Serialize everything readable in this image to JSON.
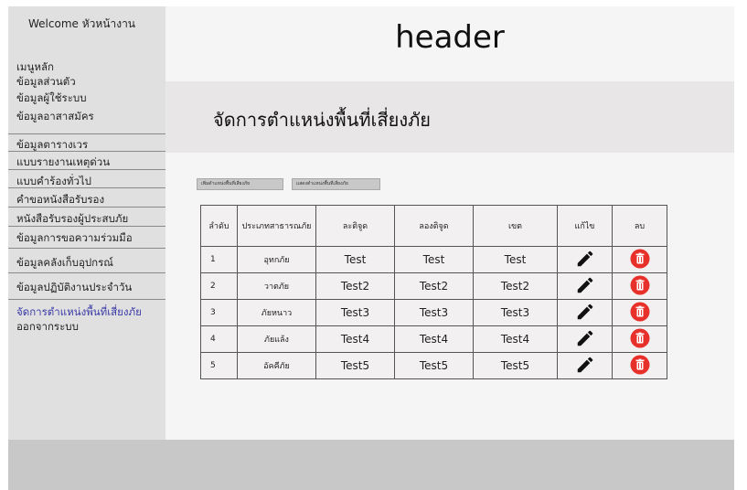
{
  "sidebar": {
    "welcome": "Welcome หัวหน้างาน",
    "items": [
      {
        "label": "เมนูหลัก"
      },
      {
        "label": "ข้อมูลส่วนตัว"
      },
      {
        "label": "ข้อมูลผู้ใช้ระบบ"
      },
      {
        "label": "ข้อมูลอาสาสมัคร"
      },
      {
        "label": "ข้อมูลตารางเวร"
      },
      {
        "label": "แบบรายงานเหตุด่วน"
      },
      {
        "label": "แบบคำร้องทั่วไป"
      },
      {
        "label": "คำขอหนังสือรับรอง"
      },
      {
        "label": "หนังสือรับรองผู้ประสบภัย"
      },
      {
        "label": "ข้อมูลการขอความร่วมมือ"
      },
      {
        "label": "ข้อมูลคลังเก็บอุปกรณ์"
      },
      {
        "label": "ข้อมูลปฏิบัติงานประจำวัน"
      },
      {
        "label": "จัดการตำแหน่งพื้นที่เสี่ยงภัย"
      },
      {
        "label": "ออกจากระบบ"
      }
    ]
  },
  "header": {
    "title": "header"
  },
  "page": {
    "title": "จัดการตำแหน่งพื้นที่เสี่ยงภัย"
  },
  "toolbar": {
    "add_label": "เพิ่มตำแหน่งพื้นที่เสี่ยงภัย",
    "show_label": "แสดงตำแหน่งพื้นที่เสี่ยงภัย"
  },
  "table": {
    "headers": {
      "no": "ลำดับ",
      "type": "ประเภทสาธารณภัย",
      "lat": "ละติจูด",
      "lng": "ลองติจูด",
      "zone": "เขต",
      "edit": "แก้ไข",
      "delete": "ลบ"
    },
    "rows": [
      {
        "no": "1",
        "type": "อุทกภัย",
        "lat": "Test",
        "lng": "Test",
        "zone": "Test"
      },
      {
        "no": "2",
        "type": "วาตภัย",
        "lat": "Test2",
        "lng": "Test2",
        "zone": "Test2"
      },
      {
        "no": "3",
        "type": "ภัยหนาว",
        "lat": "Test3",
        "lng": "Test3",
        "zone": "Test3"
      },
      {
        "no": "4",
        "type": "ภัยแล้ง",
        "lat": "Test4",
        "lng": "Test4",
        "zone": "Test4"
      },
      {
        "no": "5",
        "type": "อัคคีภัย",
        "lat": "Test5",
        "lng": "Test5",
        "zone": "Test5"
      }
    ]
  },
  "icons": {
    "edit": "pencil-icon",
    "delete": "trash-icon"
  },
  "colors": {
    "delete_icon_bg": "#e8302a",
    "active_nav": "#3a3aa8"
  }
}
